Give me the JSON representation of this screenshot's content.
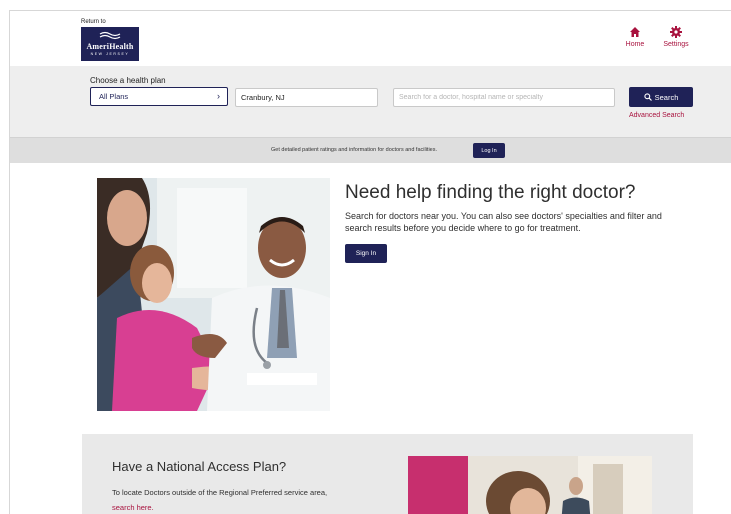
{
  "header": {
    "return_label": "Return to",
    "logo_name": "AmeriHealth",
    "logo_sub": "NEW JERSEY",
    "nav": {
      "home_label": "Home",
      "settings_label": "Settings"
    }
  },
  "search": {
    "plan_label": "Choose a health plan",
    "plan_value": "All Plans",
    "plan_chevron": "›",
    "location_value": "Cranbury, NJ",
    "doctor_placeholder": "Search for a doctor, hospital name or specialty",
    "search_button_label": "Search",
    "advanced_link": "Advanced Search"
  },
  "info_bar": {
    "text": "Get detailed patient ratings and information for doctors and facilities.",
    "login_label": "Log In"
  },
  "hero": {
    "title": "Need help finding the right doctor?",
    "description": "Search for doctors near you. You can also see doctors' specialties and filter and search results before you decide where to go for treatment.",
    "signin_label": "Sign In"
  },
  "national_access": {
    "title": "Have a National Access Plan?",
    "text": "To locate Doctors outside of the Regional Preferred service area,",
    "link": "search here."
  },
  "icons": {
    "home": "home-icon",
    "settings": "gear-icon",
    "search": "search-icon",
    "chevron": "chevron-right-icon"
  },
  "colors": {
    "brand_navy": "#1f2257",
    "accent_red": "#a8123e",
    "band_gray": "#eeeeee",
    "info_gray": "#dedede",
    "panel_gray": "#e9e9e9"
  }
}
